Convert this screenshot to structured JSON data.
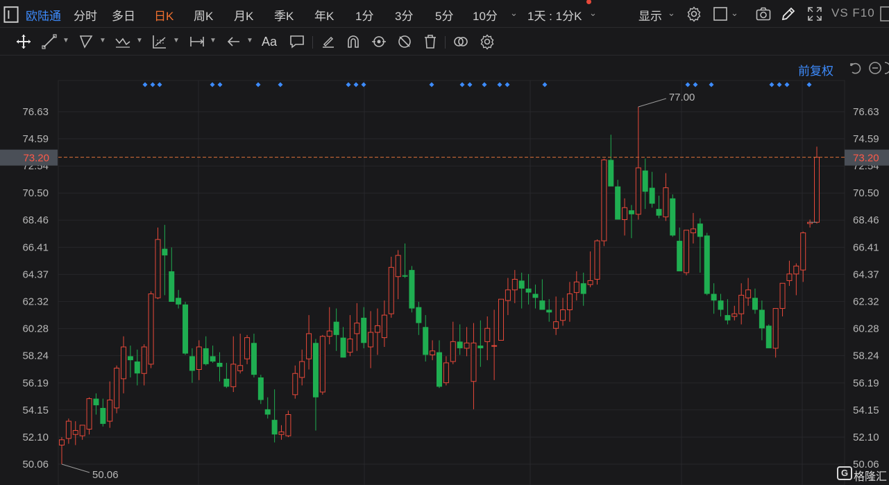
{
  "toolbar": {
    "brand": "欧陆通",
    "tabs": [
      "分时",
      "多日",
      "日K",
      "周K",
      "月K",
      "季K",
      "年K",
      "1分",
      "3分",
      "5分",
      "10分"
    ],
    "active_tab": "日K",
    "period_select": "1天 : 1分K",
    "display_label": "显示",
    "right_label": "VS F10"
  },
  "drawing_tools": {
    "icons": [
      "move-icon",
      "line-icon",
      "polyline-icon",
      "wave-icon",
      "fib-icon",
      "measure-icon",
      "arrow-icon",
      "text-icon",
      "comment-icon",
      "eraser-icon",
      "magnet-icon",
      "eye-icon",
      "hide-icon",
      "trash-icon",
      "compare-icon",
      "settings-icon"
    ],
    "text_tool_label": "Aa"
  },
  "chart_header": {
    "adjust_label": "前复权"
  },
  "chart_data": {
    "type": "candlestick",
    "y_ticks": [
      76.63,
      74.59,
      72.54,
      70.5,
      68.46,
      66.41,
      64.37,
      62.32,
      60.28,
      58.24,
      56.19,
      54.15,
      52.1,
      50.06
    ],
    "ylim": [
      49.8,
      80.0
    ],
    "current_price": "73.20",
    "current_price_value": 73.2,
    "max_label": "77.00",
    "max_value": 77.0,
    "min_label": "50.06",
    "min_value": 50.06,
    "event_marker_groups": [
      [
        209,
        220,
        230
      ],
      [
        306,
        317
      ],
      [
        372
      ],
      [
        404
      ],
      [
        502,
        513,
        524
      ],
      [
        622
      ],
      [
        666,
        677
      ],
      [
        698
      ],
      [
        720,
        731
      ],
      [
        785
      ],
      [
        991,
        1002
      ],
      [
        1025
      ],
      [
        1112,
        1123,
        1134
      ],
      [
        1166
      ]
    ],
    "colors": {
      "up": "#e8493a",
      "down": "#1fae51",
      "marker": "#3d8bfd",
      "price_line": "#e0723a"
    },
    "candles": [
      [
        51.5,
        52.1,
        50.06,
        51.9
      ],
      [
        52.0,
        53.5,
        51.6,
        53.3
      ],
      [
        52.3,
        53.3,
        51.5,
        52.6
      ],
      [
        52.2,
        53.0,
        51.9,
        53.0
      ],
      [
        52.7,
        55.1,
        52.3,
        55.0
      ],
      [
        55.0,
        55.4,
        53.8,
        54.5
      ],
      [
        54.3,
        55.0,
        52.9,
        53.1
      ],
      [
        53.3,
        56.3,
        52.8,
        54.9
      ],
      [
        54.3,
        57.5,
        53.9,
        57.3
      ],
      [
        56.5,
        59.7,
        55.4,
        58.9
      ],
      [
        58.2,
        59.0,
        56.6,
        57.9
      ],
      [
        57.8,
        58.7,
        56.0,
        56.9
      ],
      [
        56.9,
        59.1,
        56.0,
        58.9
      ],
      [
        57.6,
        63.1,
        57.3,
        62.9
      ],
      [
        62.6,
        67.9,
        62.5,
        67.0
      ],
      [
        66.3,
        68.1,
        62.8,
        65.8
      ],
      [
        64.6,
        66.4,
        62.3,
        62.3
      ],
      [
        62.6,
        63.2,
        61.8,
        62.1
      ],
      [
        62.1,
        62.3,
        58.3,
        58.4
      ],
      [
        58.2,
        58.8,
        56.2,
        57.1
      ],
      [
        57.2,
        59.4,
        56.4,
        58.9
      ],
      [
        58.8,
        59.7,
        57.5,
        57.6
      ],
      [
        58.2,
        59.0,
        57.7,
        57.8
      ],
      [
        57.7,
        58.5,
        56.3,
        57.4
      ],
      [
        56.5,
        57.7,
        55.8,
        55.9
      ],
      [
        55.9,
        59.7,
        55.5,
        57.6
      ],
      [
        57.1,
        59.9,
        56.9,
        57.5
      ],
      [
        58.0,
        59.8,
        57.6,
        59.6
      ],
      [
        59.2,
        59.9,
        56.6,
        56.8
      ],
      [
        56.6,
        56.8,
        54.6,
        54.9
      ],
      [
        54.2,
        55.1,
        53.5,
        53.8
      ],
      [
        53.4,
        55.7,
        51.7,
        52.3
      ],
      [
        52.3,
        53.0,
        51.9,
        52.5
      ],
      [
        52.2,
        54.1,
        52.1,
        53.8
      ],
      [
        55.3,
        57.5,
        55.0,
        56.9
      ],
      [
        56.6,
        58.7,
        56.0,
        57.8
      ],
      [
        58.0,
        61.3,
        57.2,
        59.9
      ],
      [
        59.2,
        59.5,
        52.6,
        55.1
      ],
      [
        55.5,
        59.8,
        55.3,
        59.7
      ],
      [
        59.7,
        61.9,
        59.1,
        60.1
      ],
      [
        60.8,
        61.8,
        58.6,
        59.8
      ],
      [
        59.6,
        60.4,
        58.1,
        58.1
      ],
      [
        58.5,
        61.3,
        58.2,
        59.5
      ],
      [
        59.9,
        62.2,
        58.6,
        60.7
      ],
      [
        61.1,
        61.9,
        58.8,
        59.2
      ],
      [
        58.9,
        61.6,
        57.3,
        60.0
      ],
      [
        60.0,
        61.8,
        58.3,
        60.5
      ],
      [
        59.6,
        62.4,
        58.9,
        61.3
      ],
      [
        61.4,
        65.7,
        61.1,
        64.9
      ],
      [
        64.2,
        66.2,
        62.5,
        65.8
      ],
      [
        64.3,
        66.7,
        64.1,
        64.2
      ],
      [
        64.7,
        65.0,
        61.5,
        61.8
      ],
      [
        61.9,
        62.3,
        59.8,
        60.7
      ],
      [
        60.4,
        61.3,
        57.8,
        58.3
      ],
      [
        58.3,
        59.4,
        57.9,
        58.6
      ],
      [
        58.5,
        59.4,
        55.8,
        55.9
      ],
      [
        56.2,
        58.2,
        56.0,
        57.7
      ],
      [
        57.8,
        60.8,
        57.6,
        59.3
      ],
      [
        59.3,
        60.6,
        58.3,
        58.8
      ],
      [
        58.8,
        60.4,
        58.2,
        59.2
      ],
      [
        56.3,
        60.7,
        54.2,
        59.2
      ],
      [
        59.0,
        60.9,
        57.4,
        58.8
      ],
      [
        59.3,
        61.2,
        57.9,
        60.3
      ],
      [
        59.0,
        61.7,
        56.4,
        59.0
      ],
      [
        59.4,
        62.5,
        59.4,
        62.5
      ],
      [
        62.4,
        64.1,
        61.3,
        63.2
      ],
      [
        63.2,
        64.7,
        62.2,
        64.0
      ],
      [
        63.9,
        64.5,
        61.8,
        63.3
      ],
      [
        63.3,
        64.4,
        62.1,
        63.0
      ],
      [
        62.9,
        63.6,
        61.8,
        62.6
      ],
      [
        62.4,
        64.0,
        61.7,
        61.7
      ],
      [
        61.7,
        62.5,
        60.8,
        61.5
      ],
      [
        60.3,
        62.7,
        59.8,
        60.8
      ],
      [
        60.9,
        62.6,
        60.5,
        61.7
      ],
      [
        61.7,
        63.8,
        60.8,
        62.9
      ],
      [
        63.0,
        64.6,
        62.4,
        63.8
      ],
      [
        63.7,
        64.5,
        62.0,
        62.9
      ],
      [
        63.6,
        66.1,
        63.4,
        63.9
      ],
      [
        64.0,
        67.0,
        63.6,
        66.9
      ],
      [
        66.9,
        73.1,
        66.5,
        73.0
      ],
      [
        73.0,
        74.9,
        71.5,
        71.0
      ],
      [
        71.0,
        71.5,
        69.4,
        68.5
      ],
      [
        68.5,
        70.1,
        67.3,
        69.4
      ],
      [
        69.2,
        69.6,
        67.1,
        68.9
      ],
      [
        68.9,
        77.0,
        68.5,
        72.4
      ],
      [
        72.2,
        73.1,
        69.3,
        70.6
      ],
      [
        70.9,
        72.1,
        69.4,
        69.7
      ],
      [
        69.3,
        70.3,
        68.6,
        68.8
      ],
      [
        68.7,
        72.0,
        68.4,
        70.9
      ],
      [
        70.1,
        70.4,
        67.2,
        67.3
      ],
      [
        66.9,
        67.9,
        65.9,
        64.6
      ],
      [
        64.5,
        67.7,
        64.3,
        67.7
      ],
      [
        67.5,
        69.0,
        66.7,
        67.8
      ],
      [
        68.2,
        68.6,
        64.5,
        67.2
      ],
      [
        67.3,
        67.5,
        62.8,
        62.9
      ],
      [
        62.9,
        63.7,
        61.4,
        62.4
      ],
      [
        62.4,
        62.9,
        61.2,
        61.7
      ],
      [
        61.3,
        62.5,
        60.6,
        60.9
      ],
      [
        61.2,
        62.0,
        60.9,
        61.4
      ],
      [
        61.4,
        63.7,
        60.6,
        62.8
      ],
      [
        62.6,
        64.1,
        62.0,
        63.2
      ],
      [
        62.6,
        63.3,
        61.4,
        61.7
      ],
      [
        61.7,
        62.4,
        59.4,
        60.3
      ],
      [
        60.5,
        60.6,
        58.9,
        58.8
      ],
      [
        58.8,
        61.6,
        58.1,
        61.8
      ],
      [
        61.8,
        62.9,
        61.2,
        63.7
      ],
      [
        63.9,
        65.4,
        63.5,
        64.4
      ],
      [
        64.4,
        65.2,
        62.8,
        65.0
      ],
      [
        64.7,
        67.6,
        63.8,
        67.5
      ],
      [
        68.2,
        68.5,
        67.9,
        68.3
      ],
      [
        68.3,
        74.0,
        68.2,
        73.2
      ]
    ]
  },
  "watermark": "格隆汇"
}
